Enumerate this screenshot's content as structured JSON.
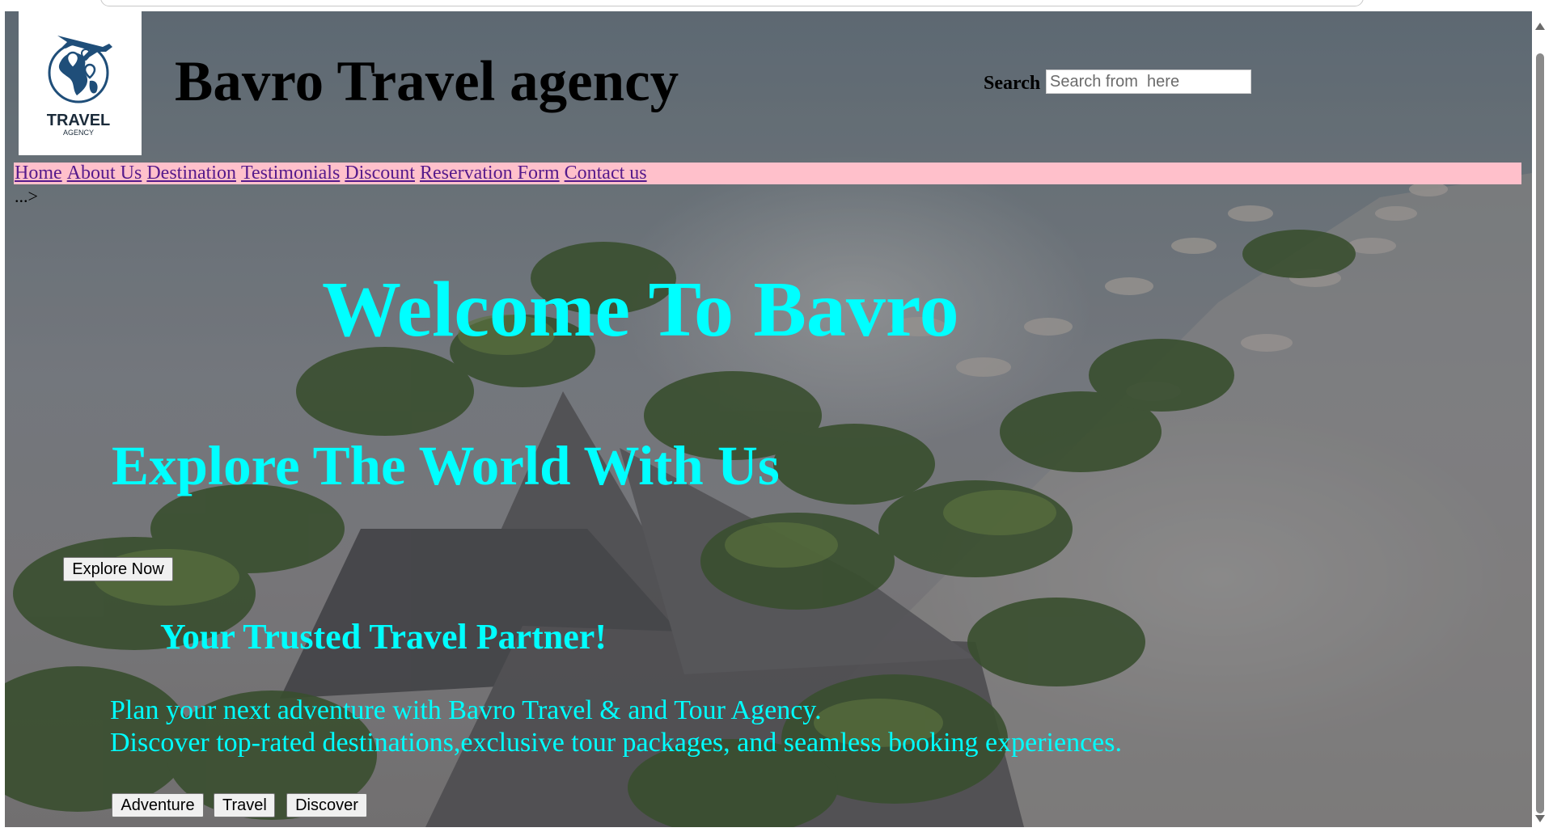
{
  "header": {
    "logo_text": "TRAVEL",
    "logo_subtext": "AGENCY",
    "title": "Bavro Travel agency",
    "search_label": "Search",
    "search_placeholder": "Search from  here"
  },
  "nav": {
    "items": [
      {
        "label": "Home"
      },
      {
        "label": "About Us"
      },
      {
        "label": "Destination"
      },
      {
        "label": "Testimonials"
      },
      {
        "label": "Discount"
      },
      {
        "label": "Reservation Form"
      },
      {
        "label": "Contact us"
      }
    ],
    "stray_text": "...>"
  },
  "hero": {
    "welcome": "Welcome To Bavro",
    "explore": "Explore The World With Us",
    "explore_button": "Explore Now",
    "partner": "Your Trusted Travel Partner!",
    "plan_line1": "Plan your next adventure with Bavro Travel & and Tour Agency.",
    "plan_line2": "Discover top-rated destinations,exclusive tour packages, and seamless booking experiences.",
    "buttons": [
      {
        "label": "Adventure"
      },
      {
        "label": "Travel"
      },
      {
        "label": "Discover"
      }
    ]
  },
  "colors": {
    "nav_background": "#ffc0cb",
    "hero_text": "#00ffff",
    "link": "#551a8b",
    "logo_blue": "#1f4e79"
  },
  "icons": {
    "logo": "globe-airplane-icon"
  }
}
